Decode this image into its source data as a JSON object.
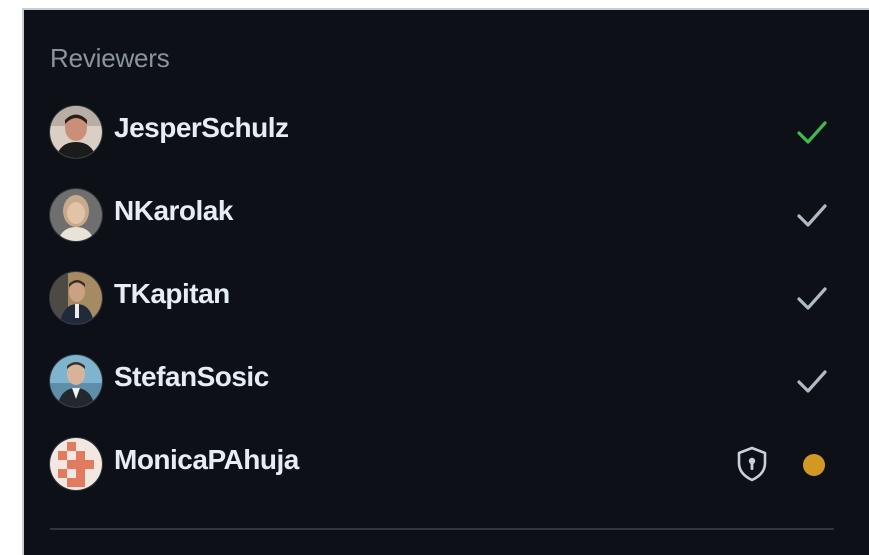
{
  "reviewers_panel": {
    "title": "Reviewers",
    "reviewers": [
      {
        "name": "JesperSchulz",
        "status": "approved",
        "status_icon": "check-icon",
        "status_color": "#3fb950"
      },
      {
        "name": "NKarolak",
        "status": "approved",
        "status_icon": "check-icon",
        "status_color": "#b1bac4"
      },
      {
        "name": "TKapitan",
        "status": "approved",
        "status_icon": "check-icon",
        "status_color": "#b1bac4"
      },
      {
        "name": "StefanSosic",
        "status": "approved",
        "status_icon": "check-icon",
        "status_color": "#b1bac4"
      },
      {
        "name": "MonicaPAhuja",
        "status": "pending",
        "status_icon": "dot-icon",
        "status_color": "#d29922",
        "extra_icon": "shield-lock-icon"
      }
    ]
  },
  "colors": {
    "background": "#0d1117",
    "title": "#8b949e",
    "name": "#e6edf3",
    "divider": "#30363d"
  }
}
